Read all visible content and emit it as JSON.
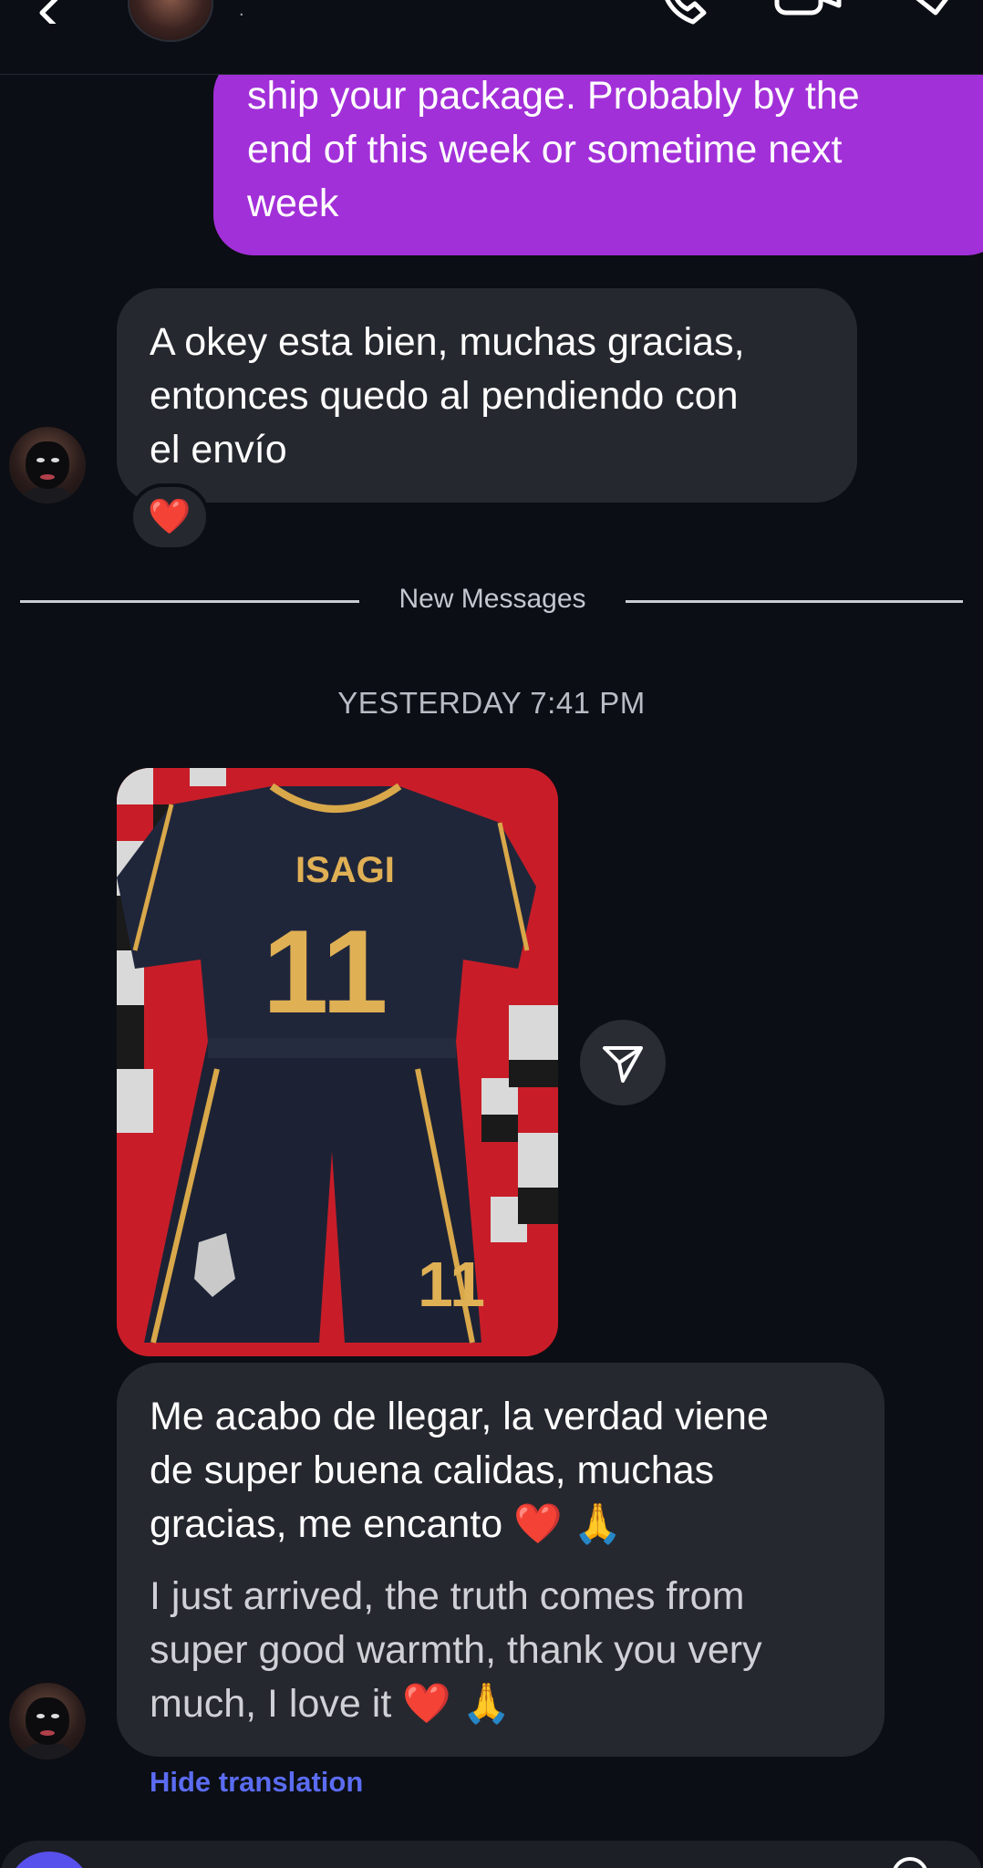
{
  "header": {
    "name_text": ".",
    "icons": [
      "chevron-left-icon",
      "phone-icon",
      "video-camera-icon",
      "tag-icon"
    ]
  },
  "messages": {
    "outgoing": {
      "lines": [
        "ship your package. Probably by the",
        "end of this week or sometime next",
        "week"
      ]
    },
    "incoming_1": {
      "lines": [
        "A okey esta bien, muchas gracias,",
        "entonces quedo al pendiendo con",
        "el envío"
      ],
      "reaction": "❤️"
    },
    "divider_label": "New Messages",
    "timestamp": "YESTERDAY 7:41 PM",
    "photo": {
      "jersey_name": "ISAGI",
      "jersey_number": "11",
      "shorts_number": "11"
    },
    "incoming_2": {
      "original_lines": [
        "Me acabo de llegar, la verdad viene",
        "de super buena calidas, muchas",
        "gracias, me encanto ❤️ 🙏"
      ],
      "translated_lines": [
        "I just arrived, the truth comes from",
        "super good warmth, thank you very",
        "much, I love it ❤️  🙏"
      ]
    },
    "hide_translation": "Hide translation"
  },
  "colors": {
    "background": "#0b0e14",
    "outgoing_bubble": "#a230d8",
    "incoming_bubble": "#26282f",
    "link": "#5b6cf2"
  }
}
